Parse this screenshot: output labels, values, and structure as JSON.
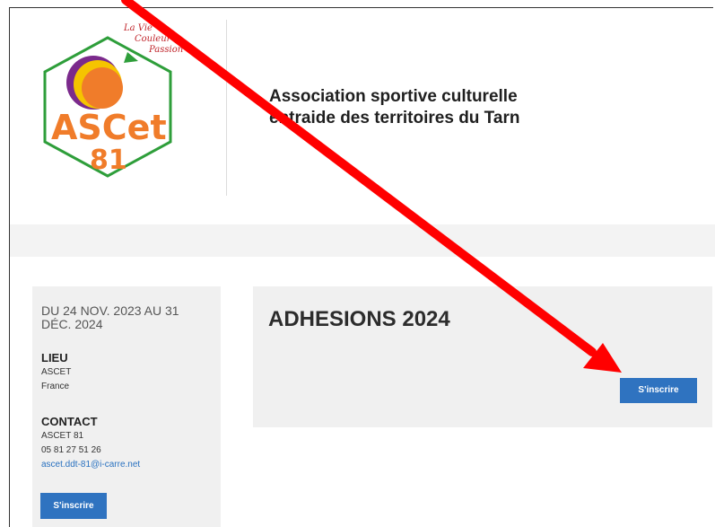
{
  "logo": {
    "name": "ASCet",
    "number": "81",
    "slogan_line1": "La Vie",
    "slogan_line2": "Couleur",
    "slogan_line3": "Passion"
  },
  "header": {
    "tagline_line1": "Association sportive culturelle",
    "tagline_line2": "entraide des territoires du Tarn"
  },
  "sidebar": {
    "dates": "DU 24 NOV. 2023 AU 31 DÉC. 2024",
    "lieu_title": "LIEU",
    "lieu_line1": "ASCET",
    "lieu_line2": "France",
    "contact_title": "CONTACT",
    "contact_name": "ASCET 81",
    "contact_phone": "05 81 27 51 26",
    "contact_email": "ascet.ddt-81@i-carre.net",
    "button_label": "S'inscrire"
  },
  "main": {
    "title": "ADHESIONS 2024",
    "button_label": "S'inscrire"
  },
  "colors": {
    "accent": "#2f73c0",
    "annotation_arrow": "#ff0000",
    "logo_green": "#2e9e3a",
    "logo_orange": "#f07c2a"
  }
}
